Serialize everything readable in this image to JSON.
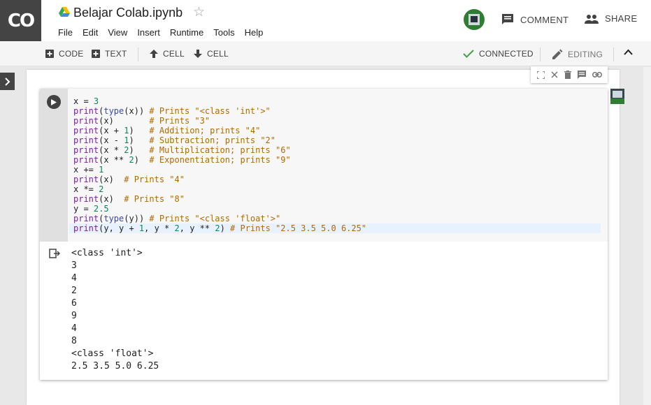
{
  "app": {
    "logo": "CO",
    "title": "Belajar Colab.ipynb"
  },
  "menu": [
    "File",
    "Edit",
    "View",
    "Insert",
    "Runtime",
    "Tools",
    "Help"
  ],
  "header": {
    "comment_label": "COMMENT",
    "share_label": "SHARE"
  },
  "toolbar": {
    "add_code": "CODE",
    "add_text": "TEXT",
    "cell_up": "CELL",
    "cell_down": "CELL",
    "status": "CONNECTED",
    "mode": "EDITING"
  },
  "colors": {
    "accent": "#43a047",
    "header_logo_bg": "#444444"
  },
  "icons": [
    "drive-icon",
    "star-icon",
    "comment-icon",
    "share-people-icon",
    "plus-icon",
    "arrow-up-icon",
    "arrow-down-icon",
    "check-icon",
    "pencil-icon",
    "chevron-up-icon",
    "run-play-icon",
    "output-icon",
    "expand-icon",
    "close-icon",
    "delete-icon",
    "comment-icon",
    "link-icon"
  ],
  "code_lines": [
    "x = 3",
    "print(type(x)) # Prints \"<class 'int'>\"",
    "print(x)       # Prints \"3\"",
    "print(x + 1)   # Addition; prints \"4\"",
    "print(x - 1)   # Subtraction; prints \"2\"",
    "print(x * 2)   # Multiplication; prints \"6\"",
    "print(x ** 2)  # Exponentiation; prints \"9\"",
    "x += 1",
    "print(x)  # Prints \"4\"",
    "x *= 2",
    "print(x)  # Prints \"8\"",
    "y = 2.5",
    "print(type(y)) # Prints \"<class 'float'>\"",
    "print(y, y + 1, y * 2, y ** 2) # Prints \"2.5 3.5 5.0 6.25\""
  ],
  "output_lines": [
    "<class 'int'>",
    "3",
    "4",
    "2",
    "6",
    "9",
    "4",
    "8",
    "<class 'float'>",
    "2.5 3.5 5.0 6.25"
  ]
}
